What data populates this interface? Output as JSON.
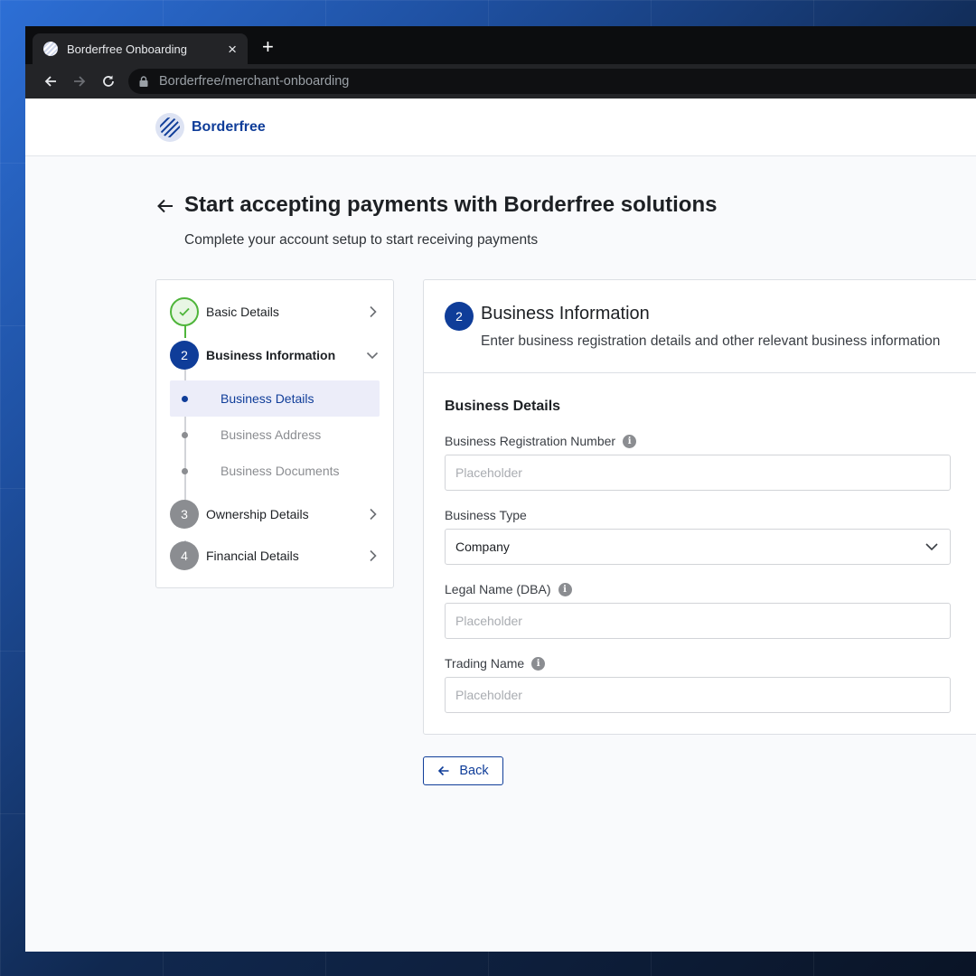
{
  "browser": {
    "tab_title": "Borderfree Onboarding",
    "tab_close": "×",
    "new_tab": "+",
    "url": "Borderfree/merchant-onboarding"
  },
  "header": {
    "logo_text": "Borderfree"
  },
  "page": {
    "title": "Start accepting payments with Borderfree solutions",
    "subtitle": "Complete your account setup to start receiving payments"
  },
  "stepper": {
    "steps": [
      {
        "number": "",
        "label": "Basic Details",
        "status": "complete"
      },
      {
        "number": "2",
        "label": "Business Information",
        "status": "active"
      },
      {
        "number": "3",
        "label": "Ownership Details",
        "status": "pending"
      },
      {
        "number": "4",
        "label": "Financial Details",
        "status": "pending"
      }
    ],
    "substeps": [
      {
        "label": "Business Details",
        "active": true
      },
      {
        "label": "Business Address",
        "active": false
      },
      {
        "label": "Business Documents",
        "active": false
      }
    ]
  },
  "form": {
    "step_number": "2",
    "title": "Business Information",
    "description": "Enter business registration details and other relevant business information",
    "section_title": "Business Details",
    "fields": [
      {
        "label": "Business Registration Number",
        "placeholder": "Placeholder",
        "info": true
      },
      {
        "label": "Business Type",
        "value": "Company",
        "info": false
      },
      {
        "label": "Legal Name (DBA)",
        "placeholder": "Placeholder",
        "info": true
      },
      {
        "label": "Trading Name",
        "placeholder": "Placeholder",
        "info": true
      }
    ]
  },
  "actions": {
    "back_label": "Back"
  },
  "colors": {
    "brand": "#0f3d99",
    "success": "#4fb53b",
    "muted": "#8b8d91"
  }
}
